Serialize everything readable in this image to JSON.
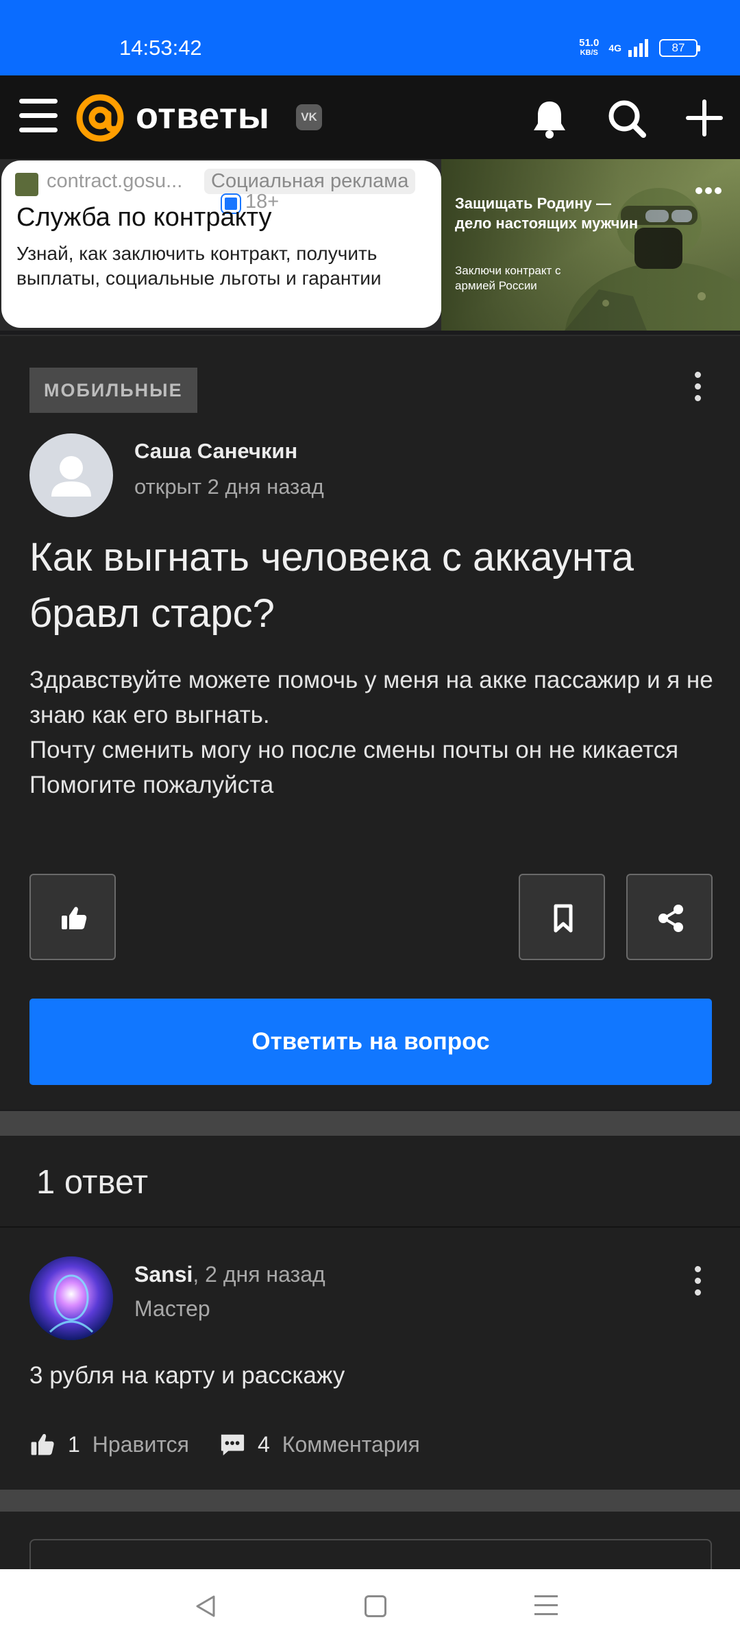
{
  "status_bar": {
    "time": "14:53:42",
    "speed_value": "51.0",
    "speed_unit": "KB/S",
    "network": "4G",
    "battery": "87"
  },
  "header": {
    "logo_text": "ответы",
    "vk_badge": "VK",
    "accent_color": "#ff9e00"
  },
  "ad": {
    "domain": "contract.gosu...",
    "label": "Социальная реклама",
    "age": "18+",
    "title": "Служба по контракту",
    "description": "Узнай, как заключить контракт, получить выплаты, социальные льготы и гарантии",
    "image_headline": "Защищать Родину — дело настоящих мужчин",
    "image_sub": "Заключи контракт с армией России"
  },
  "question": {
    "category": "МОБИЛЬНЫЕ",
    "author": "Саша Санечкин",
    "meta": "открыт 2 дня назад",
    "title": "Как выгнать человека с аккаунта бравл старс?",
    "body": "Здравствуйте можете помочь у меня на акке пассажир и я не знаю как его выгнать.\nПочту сменить могу но после смены почты он не кикается\nПомогите пожалуйста",
    "answer_button": "Ответить на вопрос"
  },
  "answers": {
    "count_label": "1 ответ",
    "items": [
      {
        "author": "Sansi",
        "time": ", 2 дня назад",
        "rank": "Мастер",
        "text": "3 рубля на карту и расскажу",
        "likes": "1",
        "likes_label": "Нравится",
        "comments": "4",
        "comments_label": "Комментария"
      }
    ]
  },
  "colors": {
    "status_bar": "#0a6cff",
    "primary_button": "#1177ff",
    "background": "#202020"
  }
}
